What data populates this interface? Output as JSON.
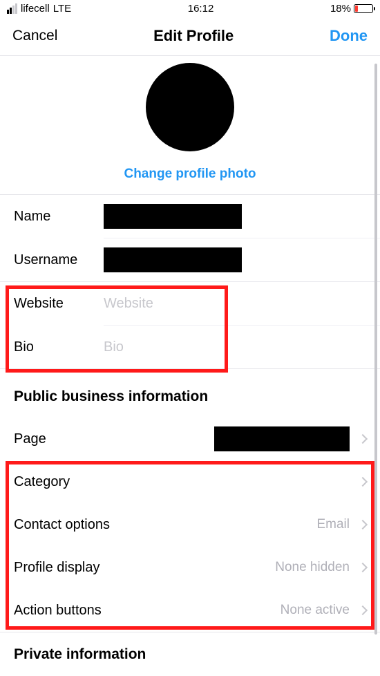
{
  "status": {
    "carrier": "lifecell",
    "net": "LTE",
    "time": "16:12",
    "battery_pct": "18%"
  },
  "nav": {
    "cancel": "Cancel",
    "title": "Edit Profile",
    "done": "Done"
  },
  "avatar": {
    "change": "Change profile photo"
  },
  "fields": {
    "name_label": "Name",
    "username_label": "Username",
    "website_label": "Website",
    "website_placeholder": "Website",
    "bio_label": "Bio",
    "bio_placeholder": "Bio"
  },
  "public": {
    "header": "Public business information",
    "page_label": "Page",
    "category_label": "Category",
    "contact_label": "Contact options",
    "contact_value": "Email",
    "display_label": "Profile display",
    "display_value": "None hidden",
    "action_label": "Action buttons",
    "action_value": "None active"
  },
  "private": {
    "header": "Private information"
  }
}
